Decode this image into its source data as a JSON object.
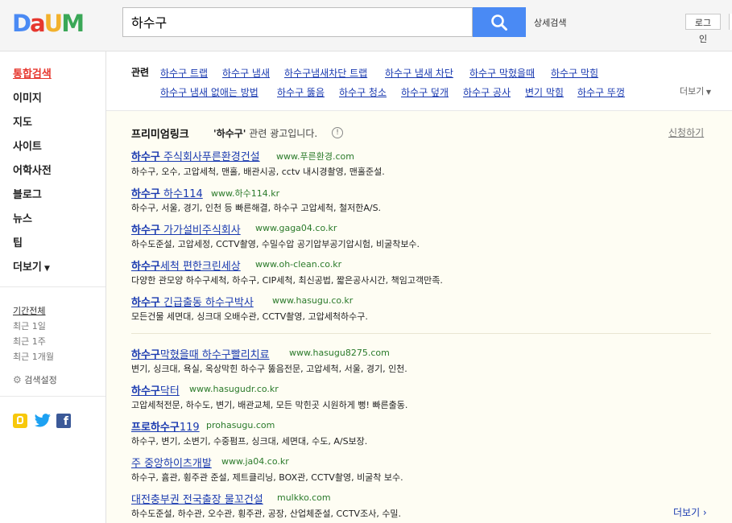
{
  "header": {
    "logo_letters": [
      "D",
      "a",
      "U",
      "M"
    ],
    "logo_colors": [
      "#4a8af4",
      "#e6372e",
      "#f2b12c",
      "#3aa757"
    ],
    "search_value": "하수구",
    "search_icon": "search-icon",
    "advanced_search": "상세검색",
    "login": "로그인"
  },
  "sidebar": {
    "nav": [
      "통합검색",
      "이미지",
      "지도",
      "사이트",
      "어학사전",
      "블로그",
      "뉴스",
      "팁",
      "더보기"
    ],
    "period": [
      "기간전체",
      "최근 1일",
      "최근 1주",
      "최근 1개월"
    ],
    "settings": "검색설정",
    "social_icons": [
      "kakao-icon",
      "twitter-icon",
      "facebook-icon"
    ]
  },
  "related": {
    "label": "관련",
    "row1": [
      "하수구 트랩",
      "하수구 냄새",
      "하수구냄새차단 트랩",
      "하수구 냄새 차단",
      "하수구 막혔을때",
      "하수구 막힘"
    ],
    "row2": [
      "하수구 냄새 없애는 방법",
      "하수구 뚫음",
      "하수구 청소",
      "하수구 덮개",
      "하수구 공사",
      "변기 막힘",
      "하수구 뚜껑"
    ],
    "more": "더보기"
  },
  "premium": {
    "title": "프리미엄링크",
    "query": "'하수구'",
    "subtitle": "관련 광고입니다.",
    "apply": "신청하기"
  },
  "ads": [
    {
      "t1": "하수구",
      "t2": " 주식회사푸른환경건설",
      "url": "www.푸른환경.com",
      "desc": "하수구, 오수, 고압세척, 맨홀, 배관시공, cctv 내시경촬영, 맨홀준설."
    },
    {
      "t1": "하수구",
      "t2": " 하수114",
      "url": "www.하수114.kr",
      "desc": "하수구, 서울, 경기, 인천 등 빠른해결, 하수구 고압세척, 철저한A/S."
    },
    {
      "t1": "하수구",
      "t2": " 가가설비주식회사",
      "url": "www.gaga04.co.kr",
      "desc": "하수도준설, 고압세정, CCTV촬영, 수밀수압 공기압부공기압시험, 비굴착보수."
    },
    {
      "t1": "하수구",
      "t2": "세척 편한크린세상",
      "url": "www.oh-clean.co.kr",
      "desc": "다양한 관모양 하수구세척, 하수구, CIP세척, 최신공법, 짧은공사시간, 책임고객만족."
    },
    {
      "t1": "하수구",
      "t2": " 긴급출동 하수구박사",
      "url": "www.hasugu.co.kr",
      "desc": "모든건물 세면대, 싱크대 오배수관, CCTV촬영, 고압세척하수구."
    },
    {
      "t1": "하수구",
      "t2": "막혔을때 하수구빨리치료",
      "url": "www.hasugu8275.com",
      "desc": "변기, 싱크대, 욕실, 옥상막힌 하수구 뚫음전문, 고압세척, 서울, 경기, 인천."
    },
    {
      "t1": "하수구",
      "t2": "닥터",
      "url": "www.hasugudr.co.kr",
      "desc": "고압세척전문, 하수도, 변기, 배관교체, 모든 막힌곳 시원하게 뻥! 빠른출동."
    },
    {
      "t1": "프로하수구",
      "t2": "119",
      "url": "prohasugu.com",
      "desc": "하수구, 변기, 소변기, 수중펌프, 싱크대, 세면대, 수도, A/S보장."
    },
    {
      "t1": "주 중앙하이츠개발",
      "t2": "",
      "url": "www.ja04.co.kr",
      "desc": "하수구, 흄관, 횡주관 준설, 제트클리닝, BOX관, CCTV촬영, 비굴착 보수."
    },
    {
      "t1": "대전충부권 전국출장 물꼬건설",
      "t2": "",
      "url": "mulkko.com",
      "desc": "하수도준설, 하수관, 오수관, 횡주관, 공장, 산업체준설, CCTV조사, 수밀."
    }
  ],
  "footer": {
    "more": "더보기 ›"
  }
}
